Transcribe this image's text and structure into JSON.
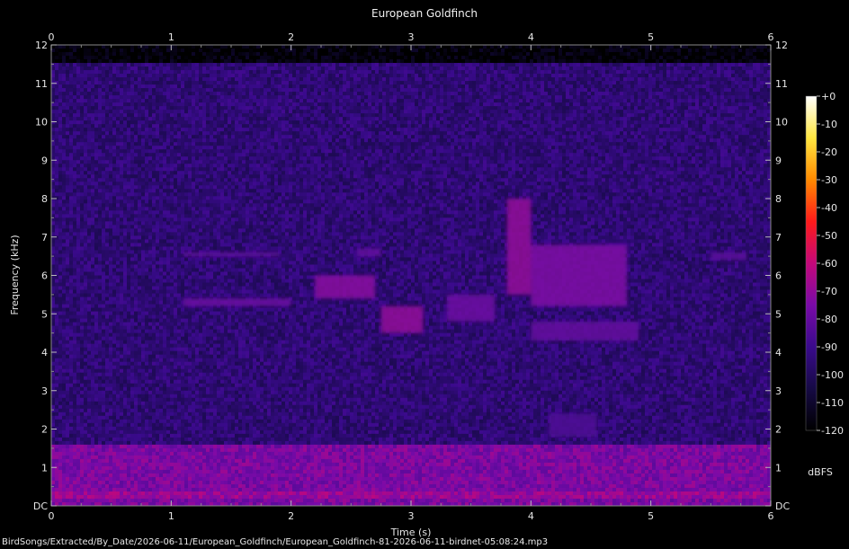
{
  "chart_data": {
    "type": "heatmap",
    "title": "European Goldfinch",
    "xlabel": "Time (s)",
    "ylabel": "Frequency (kHz)",
    "xlim": [
      0,
      6
    ],
    "ylim": [
      0,
      12
    ],
    "x_ticks": [
      "0",
      "1",
      "2",
      "3",
      "4",
      "5",
      "6"
    ],
    "y_ticks": [
      "DC",
      "1",
      "2",
      "3",
      "4",
      "5",
      "6",
      "7",
      "8",
      "9",
      "10",
      "11",
      "12"
    ],
    "colorbar": {
      "label": "dBFS",
      "range": [
        -120,
        0
      ],
      "ticks": [
        "+0",
        "-10",
        "-20",
        "-30",
        "-40",
        "-50",
        "-60",
        "-70",
        "-80",
        "-90",
        "-100",
        "-110",
        "-120"
      ],
      "stops": [
        "#000000",
        "#160a45",
        "#3a0a8c",
        "#7a0aa8",
        "#c4087a",
        "#ff1a1a",
        "#ff8a00",
        "#ffe640",
        "#ffffff"
      ]
    },
    "noise_floor_dbfs": -95,
    "low_band": {
      "freq_khz": [
        0,
        1.6
      ],
      "level_dbfs": -75
    },
    "features": [
      {
        "t": [
          1.1,
          1.9
        ],
        "f": [
          6.5,
          6.6
        ],
        "level_dbfs": -80
      },
      {
        "t": [
          1.1,
          2.0
        ],
        "f": [
          5.2,
          5.4
        ],
        "level_dbfs": -78
      },
      {
        "t": [
          2.2,
          2.7
        ],
        "f": [
          5.4,
          6.0
        ],
        "level_dbfs": -72
      },
      {
        "t": [
          2.55,
          2.75
        ],
        "f": [
          6.5,
          6.7
        ],
        "level_dbfs": -80
      },
      {
        "t": [
          2.75,
          3.1
        ],
        "f": [
          4.5,
          5.2
        ],
        "level_dbfs": -70
      },
      {
        "t": [
          3.3,
          3.7
        ],
        "f": [
          4.8,
          5.5
        ],
        "level_dbfs": -78
      },
      {
        "t": [
          3.8,
          4.0
        ],
        "f": [
          5.5,
          8.0
        ],
        "level_dbfs": -70
      },
      {
        "t": [
          4.0,
          4.8
        ],
        "f": [
          5.2,
          6.8
        ],
        "level_dbfs": -74
      },
      {
        "t": [
          4.0,
          4.9
        ],
        "f": [
          4.3,
          4.8
        ],
        "level_dbfs": -80
      },
      {
        "t": [
          4.15,
          4.55
        ],
        "f": [
          1.8,
          2.4
        ],
        "level_dbfs": -85
      },
      {
        "t": [
          5.5,
          5.8
        ],
        "f": [
          6.4,
          6.6
        ],
        "level_dbfs": -82
      }
    ]
  },
  "footer": {
    "file_path": "BirdSongs/Extracted/By_Date/2026-06-11/European_Goldfinch/European_Goldfinch-81-2026-06-11-birdnet-05:08:24.mp3"
  }
}
